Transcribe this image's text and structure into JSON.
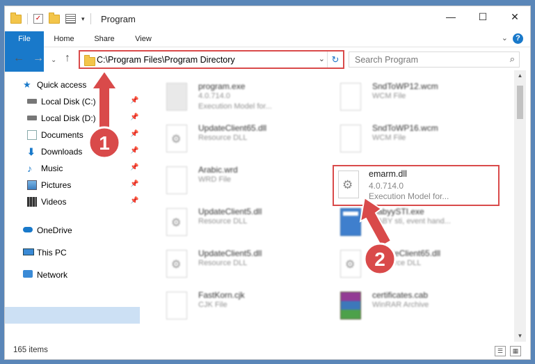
{
  "window": {
    "title": "Program",
    "controls": {
      "minimize": "—",
      "maximize": "☐",
      "close": "✕"
    }
  },
  "ribbon": {
    "tabs": [
      "File",
      "Home",
      "Share",
      "View"
    ],
    "help": "?"
  },
  "navbar": {
    "back": "←",
    "forward": "→",
    "up": "↑",
    "address": "C:\\Program Files\\Program Directory",
    "refresh": "↻",
    "search_placeholder": "Search Program",
    "search_icon": "search-icon"
  },
  "sidebar": {
    "items": [
      {
        "label": "Quick access",
        "icon": "star-icon"
      },
      {
        "label": "Local Disk (C:)",
        "icon": "drive-icon"
      },
      {
        "label": "Local Disk (D:)",
        "icon": "drive-icon"
      },
      {
        "label": "Documents",
        "icon": "documents-icon"
      },
      {
        "label": "Downloads",
        "icon": "download-arrow-icon"
      },
      {
        "label": "Music",
        "icon": "music-note-icon"
      },
      {
        "label": "Pictures",
        "icon": "pictures-icon"
      },
      {
        "label": "Videos",
        "icon": "film-icon"
      },
      {
        "label": "OneDrive",
        "icon": "cloud-icon"
      },
      {
        "label": "This PC",
        "icon": "monitor-icon"
      },
      {
        "label": "Network",
        "icon": "network-icon"
      }
    ]
  },
  "files": [
    {
      "name": "program.exe",
      "type": "4.0.714.0",
      "desc": "Execution Model for...",
      "icon": "program-icon"
    },
    {
      "name": "SndToWP12.wcm",
      "type": "WCM File",
      "desc": "",
      "icon": "blank-file-icon"
    },
    {
      "name": "UpdateClient65.dll",
      "type": "Resource DLL",
      "desc": "",
      "icon": "dll-gear-icon"
    },
    {
      "name": "SndToWP16.wcm",
      "type": "WCM File",
      "desc": "",
      "icon": "blank-file-icon"
    },
    {
      "name": "Arabic.wrd",
      "type": "WRD File",
      "desc": "",
      "icon": "blank-file-icon"
    },
    {
      "name": "UpdateClient5.dll",
      "type": "Resource DLL",
      "desc": "",
      "icon": "dll-gear-icon"
    },
    {
      "name": "BabyySTI.exe",
      "type": "BABY sti, event hand...",
      "desc": "",
      "icon": "exe-window-icon"
    },
    {
      "name": "UpdateClient5.dll",
      "type": "Resource DLL",
      "desc": "",
      "icon": "dll-gear-icon"
    },
    {
      "name": "UpdateClient65.dll",
      "type": "Resource DLL",
      "desc": "",
      "icon": "dll-gear-icon"
    },
    {
      "name": "FastKorn.cjk",
      "type": "CJK File",
      "desc": "",
      "icon": "blank-file-icon"
    },
    {
      "name": "certificates.cab",
      "type": "WinRAR Archive",
      "desc": "",
      "icon": "winrar-icon"
    }
  ],
  "highlighted_file": {
    "name": "emarm.dll",
    "version": "4.0.714.0",
    "desc": "Execution Model for..."
  },
  "status": {
    "item_count": "165 items"
  },
  "annotations": [
    {
      "number": "1",
      "color": "#d94a4a"
    },
    {
      "number": "2",
      "color": "#d94a4a"
    }
  ]
}
